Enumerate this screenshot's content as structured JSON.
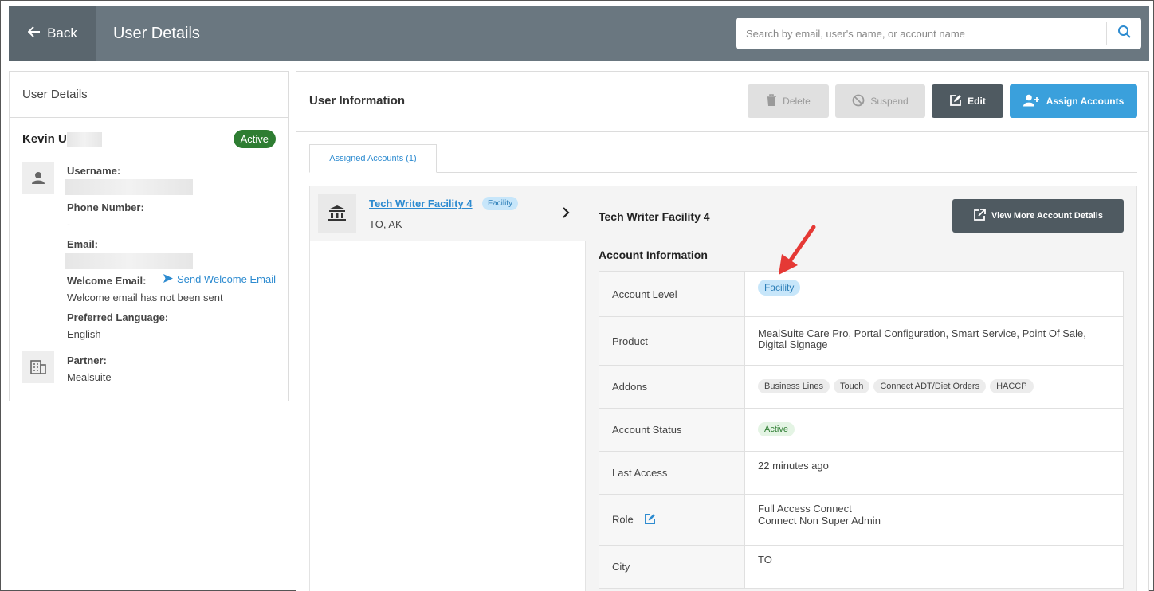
{
  "header": {
    "back_label": "Back",
    "title": "User Details",
    "search_placeholder": "Search by email, user's name, or account name"
  },
  "user_card": {
    "heading": "User Details",
    "name": "Kevin U",
    "status": "Active",
    "username_label": "Username:",
    "phone_label": "Phone Number:",
    "phone_value": "-",
    "email_label": "Email:",
    "welcome_label": "Welcome Email:",
    "welcome_link": "Send Welcome Email",
    "welcome_value": "Welcome email has not been sent",
    "language_label": "Preferred Language:",
    "language_value": "English",
    "partner_label": "Partner:",
    "partner_value": "Mealsuite"
  },
  "panel": {
    "title": "User Information",
    "buttons": {
      "delete": "Delete",
      "suspend": "Suspend",
      "edit": "Edit",
      "assign": "Assign Accounts"
    },
    "tab_label": "Assigned Accounts (1)"
  },
  "account_list": [
    {
      "name": "Tech Writer Facility 4",
      "level": "Facility",
      "location": "TO, AK"
    }
  ],
  "account_detail": {
    "title": "Tech Writer Facility 4",
    "view_more": "View More Account Details",
    "info_heading": "Account Information",
    "rows": {
      "level_label": "Account Level",
      "level_value": "Facility",
      "product_label": "Product",
      "product_value": "MealSuite Care Pro, Portal Configuration, Smart Service, Point Of Sale, Digital Signage",
      "addons_label": "Addons",
      "addons": [
        "Business Lines",
        "Touch",
        "Connect ADT/Diet Orders",
        "HACCP"
      ],
      "status_label": "Account Status",
      "status_value": "Active",
      "access_label": "Last Access",
      "access_value": "22 minutes ago",
      "role_label": "Role",
      "role_line1": "Full Access Connect",
      "role_line2": "Connect Non Super Admin",
      "city_label": "City",
      "city_value": "TO"
    }
  },
  "colors": {
    "header_bg": "#6a7780",
    "active_green": "#2e7d32",
    "primary_blue": "#3aa0dc",
    "dark_button": "#4f5a61",
    "annotation_red": "#e53935"
  }
}
